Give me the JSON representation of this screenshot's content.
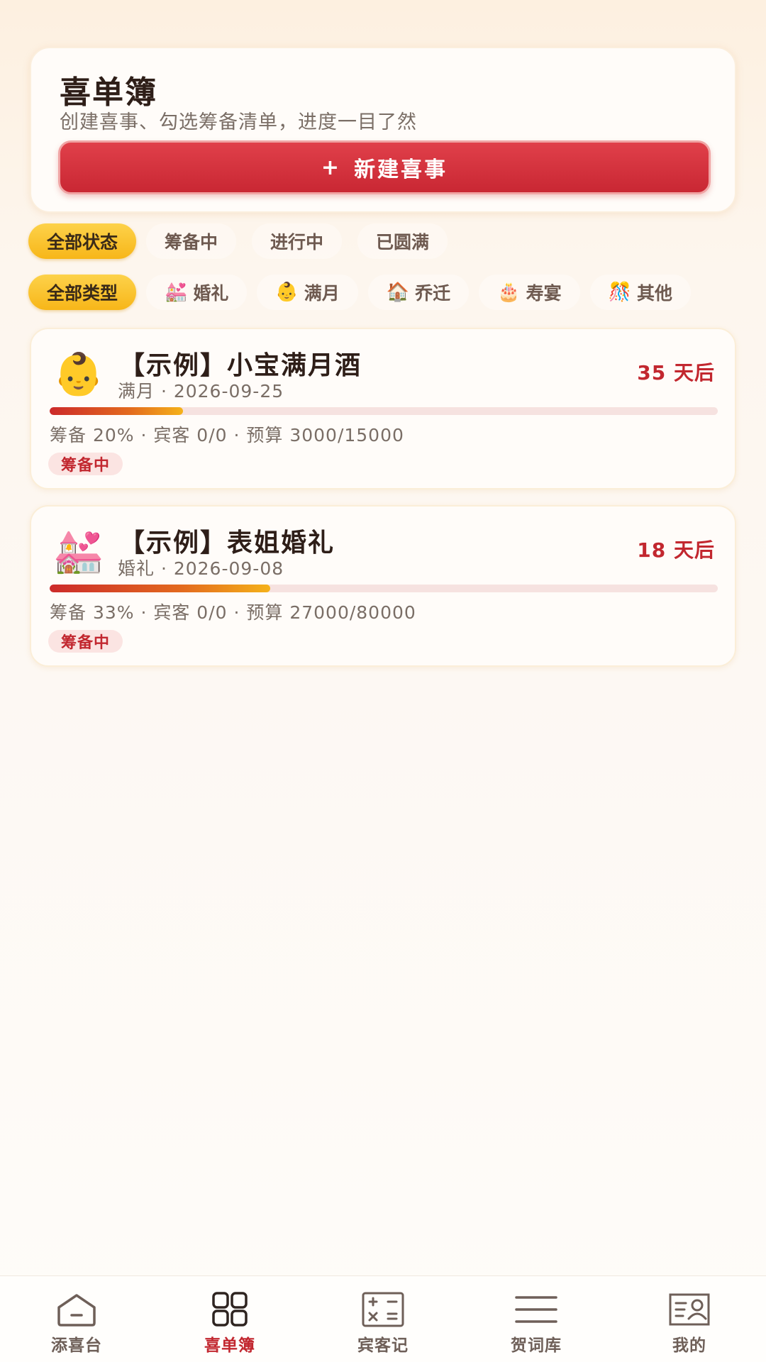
{
  "header": {
    "title": "喜单簿",
    "subtitle": "创建喜事、勾选筹备清单，进度一目了然",
    "new_button": {
      "icon": "+",
      "label": "新建喜事"
    }
  },
  "status_filters": [
    {
      "label": "全部状态",
      "active": true
    },
    {
      "label": "筹备中",
      "active": false
    },
    {
      "label": "进行中",
      "active": false
    },
    {
      "label": "已圆满",
      "active": false
    }
  ],
  "type_filters": [
    {
      "label": "全部类型",
      "emoji": "",
      "active": true
    },
    {
      "label": "婚礼",
      "emoji": "💒",
      "active": false
    },
    {
      "label": "满月",
      "emoji": "👶",
      "active": false
    },
    {
      "label": "乔迁",
      "emoji": "🏠",
      "active": false
    },
    {
      "label": "寿宴",
      "emoji": "🎂",
      "active": false
    },
    {
      "label": "其他",
      "emoji": "🎊",
      "active": false
    }
  ],
  "events": [
    {
      "icon": "👶",
      "title": "【示例】小宝满月酒",
      "subtitle": "满月 · 2026-09-25",
      "days": "35 天后",
      "progress": 0.2,
      "stats": "筹备 20% · 宾客 0/0 · 预算 3000/15000",
      "badge": "筹备中"
    },
    {
      "icon": "💒",
      "title": "【示例】表姐婚礼",
      "subtitle": "婚礼 · 2026-09-08",
      "days": "18 天后",
      "progress": 0.33,
      "stats": "筹备 33% · 宾客 0/0 · 预算 27000/80000",
      "badge": "筹备中"
    }
  ],
  "tabbar": [
    {
      "label": "添喜台",
      "icon": "home-icon",
      "active": false
    },
    {
      "label": "喜单簿",
      "icon": "grid-icon",
      "active": true
    },
    {
      "label": "宾客记",
      "icon": "calculator-icon",
      "active": false
    },
    {
      "label": "贺词库",
      "icon": "menu-lines-icon",
      "active": false
    },
    {
      "label": "我的",
      "icon": "profile-card-icon",
      "active": false
    }
  ],
  "colors": {
    "accent": "#c2272f",
    "chip_active": "#f7b619",
    "button": "#d4303a"
  }
}
